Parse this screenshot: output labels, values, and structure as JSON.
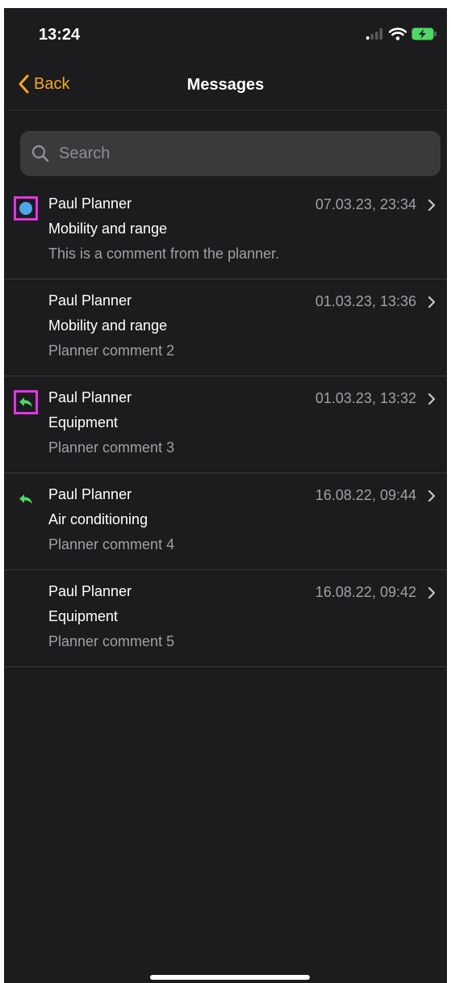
{
  "status_bar": {
    "time": "13:24"
  },
  "nav": {
    "back_label": "Back",
    "title": "Messages"
  },
  "search": {
    "placeholder": "Search"
  },
  "colors": {
    "accent": "#f5a623",
    "unread": "#4ea6e6",
    "replied": "#4cd964",
    "highlight": "#e533e5"
  },
  "messages": [
    {
      "sender": "Paul Planner",
      "date": "07.03.23, 23:34",
      "subject": "Mobility and range",
      "preview": "This is a comment from the planner.",
      "status": "unread"
    },
    {
      "sender": "Paul Planner",
      "date": "01.03.23, 13:36",
      "subject": "Mobility and range",
      "preview": "Planner comment 2",
      "status": "none"
    },
    {
      "sender": "Paul Planner",
      "date": "01.03.23, 13:32",
      "subject": "Equipment",
      "preview": "Planner comment 3",
      "status": "replied"
    },
    {
      "sender": "Paul Planner",
      "date": "16.08.22, 09:44",
      "subject": "Air conditioning",
      "preview": "Planner comment 4",
      "status": "replied"
    },
    {
      "sender": "Paul Planner",
      "date": "16.08.22, 09:42",
      "subject": "Equipment",
      "preview": "Planner comment 5",
      "status": "none"
    }
  ]
}
